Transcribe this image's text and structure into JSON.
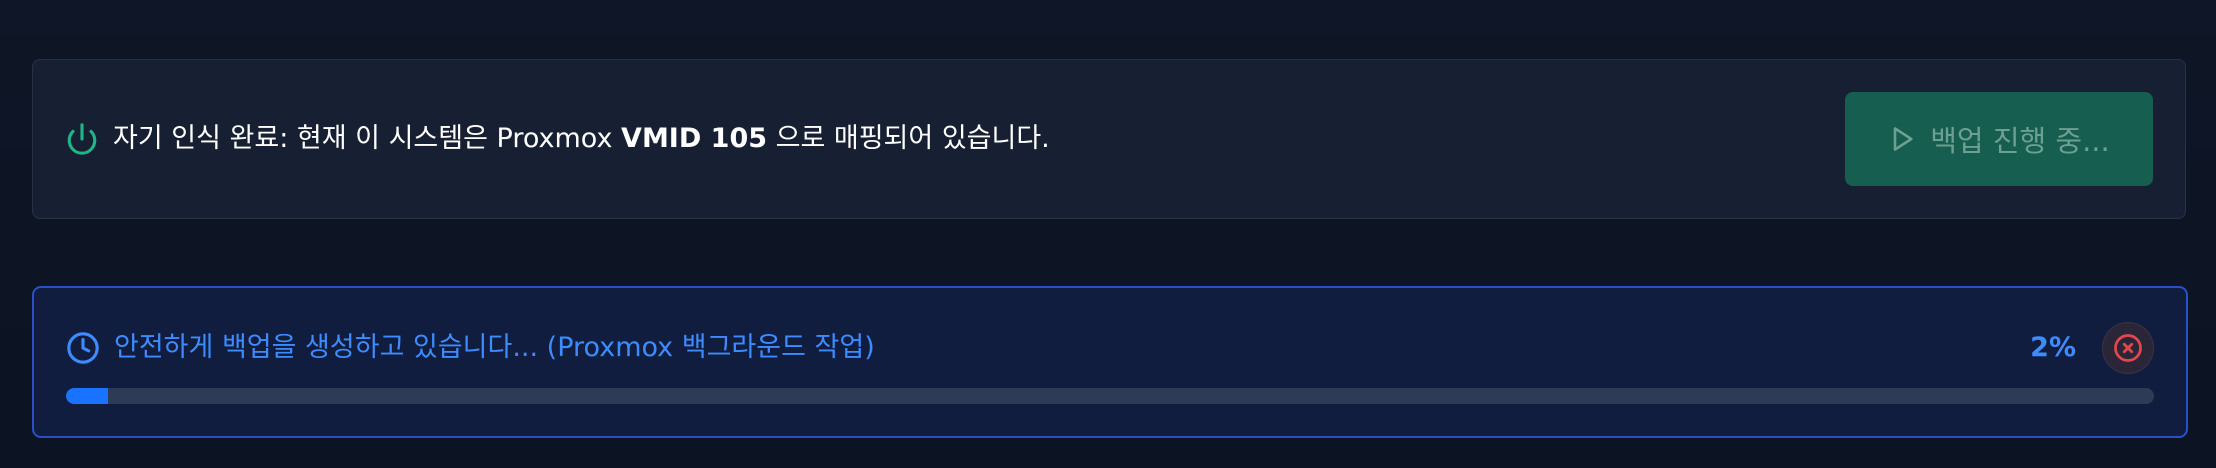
{
  "mapping_card": {
    "icon": "power-icon",
    "text_prefix": "자기 인식 완료: 현재 이 시스템은 Proxmox ",
    "vmid": "VMID 105",
    "text_suffix": " 으로 매핑되어 있습니다.",
    "button_label": "백업 진행 중...",
    "button_icon": "play-icon"
  },
  "progress_card": {
    "icon": "clock-icon",
    "status_text": "안전하게 백업을 생성하고 있습니다... (Proxmox 백그라운드 작업)",
    "percent_label": "2%",
    "progress": 0.02,
    "cancel_icon": "cancel-icon"
  },
  "colors": {
    "success_accent": "#20b486",
    "info_accent": "#3d8bff",
    "danger_accent": "#e0484d",
    "progress_fill": "#1a73ff"
  }
}
